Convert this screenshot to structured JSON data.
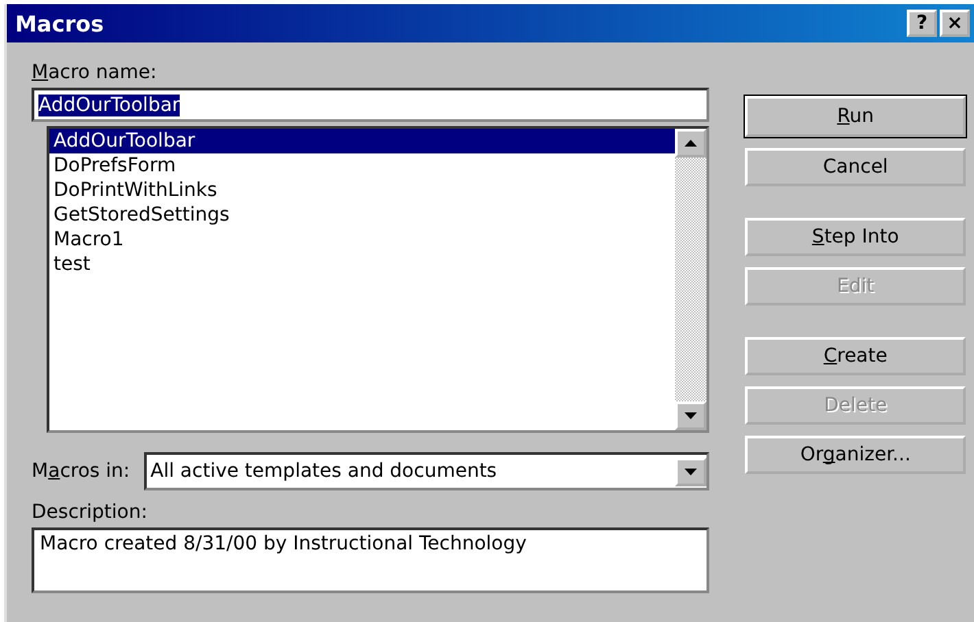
{
  "window": {
    "title": "Macros",
    "controls": [
      "?",
      "×"
    ]
  },
  "macro_name": {
    "label": [
      {
        "text": "M",
        "underlined": true
      },
      {
        "text": "acro name:",
        "underlined": false
      }
    ],
    "value": "AddOurToolbar",
    "highlighted": true
  },
  "macros": [
    {
      "name": "AddOurToolbar",
      "selected": true
    },
    {
      "name": "DoPrefsForm",
      "selected": false
    },
    {
      "name": "DoPrintWithLinks",
      "selected": false
    },
    {
      "name": "GetStoredSettings",
      "selected": false
    },
    {
      "name": "Macro1",
      "selected": false
    },
    {
      "name": "test",
      "selected": false
    }
  ],
  "macros_in": {
    "label": [
      {
        "text": "M",
        "underlined": false
      },
      {
        "text": "a",
        "underlined": true
      },
      {
        "text": "cros in:",
        "underlined": false
      }
    ],
    "value": "All active templates and documents"
  },
  "description": {
    "label": [
      {
        "text": "Description:",
        "underlined": false
      }
    ],
    "value": "Macro created 8/31/00 by Instructional Technology"
  },
  "button_groups": [
    [
      {
        "label": [
          {
            "text": "R",
            "underlined": true
          },
          {
            "text": "un",
            "underlined": false
          }
        ],
        "disabled": false,
        "default": true
      },
      {
        "label": [
          {
            "text": "Cancel",
            "underlined": false
          }
        ],
        "disabled": false,
        "default": false
      }
    ],
    [
      {
        "label": [
          {
            "text": "S",
            "underlined": true
          },
          {
            "text": "tep Into",
            "underlined": false
          }
        ],
        "disabled": false,
        "default": false
      },
      {
        "label": [
          {
            "text": "Edit",
            "underlined": false
          }
        ],
        "disabled": true,
        "default": false
      }
    ],
    [
      {
        "label": [
          {
            "text": "C",
            "underlined": true
          },
          {
            "text": "reate",
            "underlined": false
          }
        ],
        "disabled": false,
        "default": false
      },
      {
        "label": [
          {
            "text": "Delete",
            "underlined": false
          }
        ],
        "disabled": true,
        "default": false
      },
      {
        "label": [
          {
            "text": "Or",
            "underlined": false
          },
          {
            "text": "g",
            "underlined": true
          },
          {
            "text": "anizer...",
            "underlined": false
          }
        ],
        "disabled": false,
        "default": false
      }
    ]
  ]
}
